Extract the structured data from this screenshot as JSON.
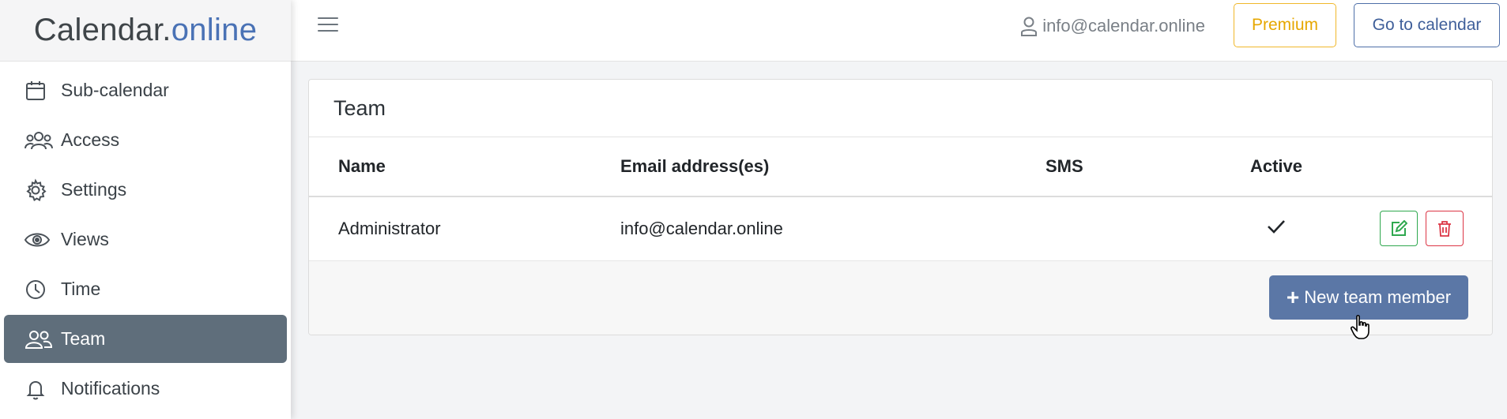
{
  "brand": {
    "part1": "Calendar.",
    "part2": "online"
  },
  "sidebar": {
    "items": [
      {
        "label": "Sub-calendar",
        "icon": "calendar-icon",
        "active": false
      },
      {
        "label": "Access",
        "icon": "users-icon",
        "active": false
      },
      {
        "label": "Settings",
        "icon": "gear-icon",
        "active": false
      },
      {
        "label": "Views",
        "icon": "eye-icon",
        "active": false
      },
      {
        "label": "Time",
        "icon": "clock-icon",
        "active": false
      },
      {
        "label": "Team",
        "icon": "team-icon",
        "active": true
      },
      {
        "label": "Notifications",
        "icon": "bell-icon",
        "active": false
      }
    ]
  },
  "header": {
    "user_email": "info@calendar.online",
    "premium_label": "Premium",
    "go_to_calendar_label": "Go to calendar"
  },
  "card": {
    "title": "Team",
    "columns": {
      "name": "Name",
      "email": "Email address(es)",
      "sms": "SMS",
      "active": "Active"
    },
    "rows": [
      {
        "name": "Administrator",
        "email": "info@calendar.online",
        "sms": "",
        "active": true
      }
    ],
    "new_member_label": "New team member"
  },
  "colors": {
    "sidebar_active": "#5f6e7b",
    "brand_accent": "#4a72b5",
    "premium": "#f0b82b",
    "primary": "#5b77a6",
    "edit": "#2fa84f",
    "delete": "#dc3545"
  }
}
